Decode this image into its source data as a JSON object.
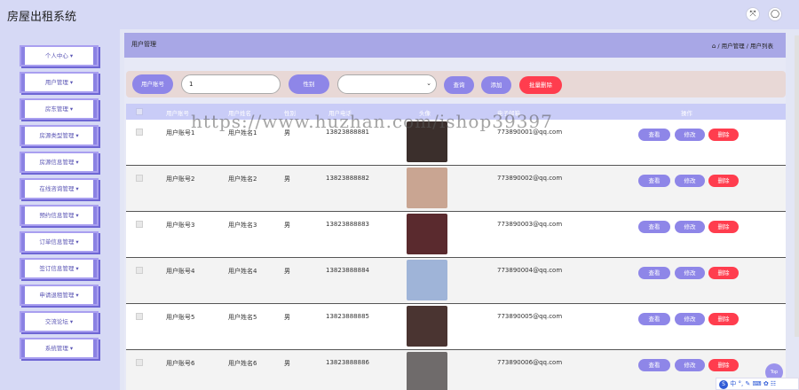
{
  "app": {
    "title": "房屋出租系统"
  },
  "header_icons": {
    "fullscreen": "fullscreen-icon",
    "user": "user-icon"
  },
  "sidebar": {
    "items": [
      {
        "label": "个人中心"
      },
      {
        "label": "用户管理"
      },
      {
        "label": "房东管理"
      },
      {
        "label": "房源类型管理"
      },
      {
        "label": "房源信息管理"
      },
      {
        "label": "在线咨询管理"
      },
      {
        "label": "预约信息管理"
      },
      {
        "label": "订单信息管理"
      },
      {
        "label": "签订信息管理"
      },
      {
        "label": "申请退租管理"
      },
      {
        "label": "交流论坛"
      },
      {
        "label": "系统管理"
      }
    ]
  },
  "page": {
    "title": "用户管理",
    "breadcrumb": "/ 用户管理 / 用户列表"
  },
  "search": {
    "account_label": "用户账号",
    "account_value": "1",
    "gender_label": "性别",
    "gender_value": "",
    "query_button": "查询",
    "add_button": "添加",
    "batch_delete_button": "批量删除"
  },
  "table": {
    "headers": [
      "用户账号",
      "用户姓名",
      "性别",
      "用户电话",
      "头像",
      "电子邮箱",
      "操作"
    ],
    "rows": [
      {
        "account": "用户账号1",
        "name": "用户姓名1",
        "gender": "男",
        "phone": "13823888881",
        "email": "773890001@qq.com",
        "avatar_color": "#3b2f2c"
      },
      {
        "account": "用户账号2",
        "name": "用户姓名2",
        "gender": "男",
        "phone": "13823888882",
        "email": "773890002@qq.com",
        "avatar_color": "#c9a592"
      },
      {
        "account": "用户账号3",
        "name": "用户姓名3",
        "gender": "男",
        "phone": "13823888883",
        "email": "773890003@qq.com",
        "avatar_color": "#5a2a2e"
      },
      {
        "account": "用户账号4",
        "name": "用户姓名4",
        "gender": "男",
        "phone": "13823888884",
        "email": "773890004@qq.com",
        "avatar_color": "#9fb4d8"
      },
      {
        "account": "用户账号5",
        "name": "用户姓名5",
        "gender": "男",
        "phone": "13823888885",
        "email": "773890005@qq.com",
        "avatar_color": "#4a3431"
      },
      {
        "account": "用户账号6",
        "name": "用户姓名6",
        "gender": "男",
        "phone": "13823888886",
        "email": "773890006@qq.com",
        "avatar_color": "#6f6b6b"
      }
    ],
    "view_label": "查看",
    "edit_label": "修改",
    "delete_label": "删除"
  },
  "watermark": "https://www.huzhan.com/ishop39397",
  "back_to_top": "Top",
  "ime_bar": "中 °, ✎ ⌨ ✿ ☷",
  "colors": {
    "accent": "#8e86e8",
    "danger": "#ff3d4e",
    "header": "#a8a7e6"
  }
}
